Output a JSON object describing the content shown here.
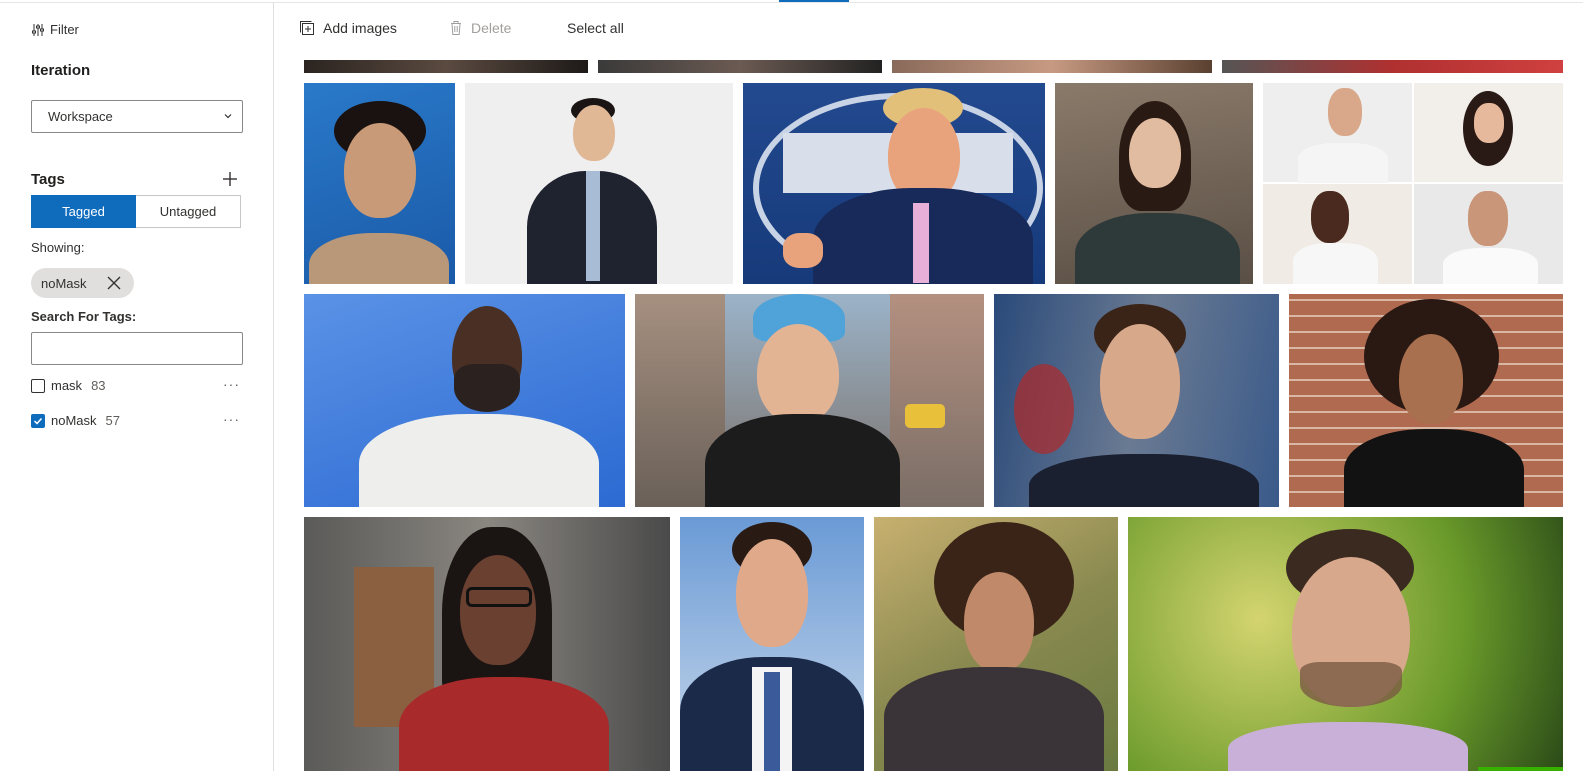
{
  "toolbar": {
    "add_images": "Add images",
    "delete": "Delete",
    "select_all": "Select all"
  },
  "sidebar": {
    "filter": "Filter",
    "iteration_title": "Iteration",
    "iteration_value": "Workspace",
    "tags_title": "Tags",
    "segment": {
      "tagged": "Tagged",
      "untagged": "Untagged",
      "selected": "Tagged"
    },
    "showing_label": "Showing:",
    "chip": "noMask",
    "search_label": "Search For Tags:",
    "search_value": "",
    "tags": [
      {
        "name": "mask",
        "count": "83",
        "checked": false
      },
      {
        "name": "noMask",
        "count": "57",
        "checked": true
      }
    ],
    "more": "···"
  },
  "colors": {
    "accent": "#0f6cbd",
    "chip_bg": "#e1dfdd",
    "divider": "#e1dfdd"
  }
}
